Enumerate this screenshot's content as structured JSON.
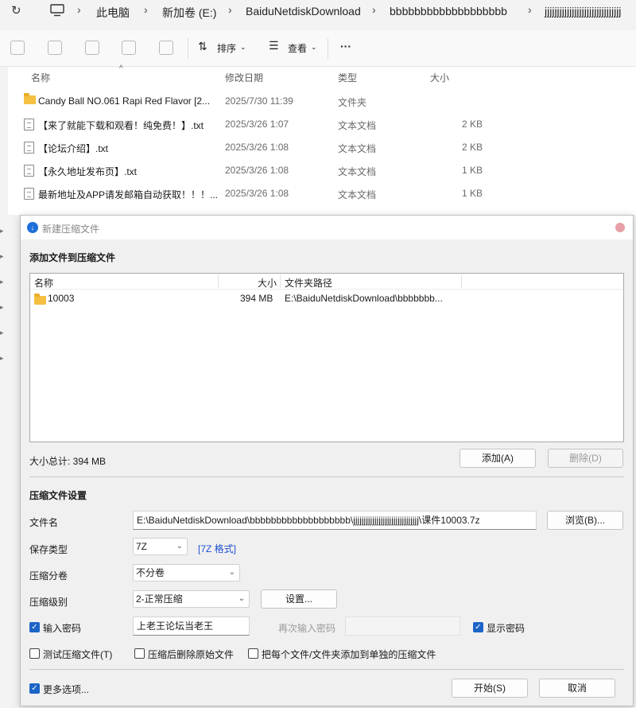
{
  "explorer": {
    "breadcrumb": [
      "此电脑",
      "新加卷 (E:)",
      "BaiduNetdiskDownload",
      "bbbbbbbbbbbbbbbbbbb",
      "jjjjjjjjjjjjjjjjjjjjjjjjjjjjjjj"
    ],
    "toolbar": {
      "sort_label": "排序",
      "view_label": "查看",
      "more_label": "···"
    },
    "columns": {
      "name": "名称",
      "date": "修改日期",
      "type": "类型",
      "size": "大小"
    },
    "files": [
      {
        "name": "Candy Ball NO.061 Rapi Red Flavor [2...",
        "date": "2025/7/30 11:39",
        "type": "文件夹",
        "size": "",
        "icon": "folder-icon"
      },
      {
        "name": "【来了就能下载和观看！纯免费！】.txt",
        "date": "2025/3/26 1:07",
        "type": "文本文档",
        "size": "2 KB",
        "icon": "text-file-icon"
      },
      {
        "name": "【论坛介绍】.txt",
        "date": "2025/3/26 1:08",
        "type": "文本文档",
        "size": "2 KB",
        "icon": "text-file-icon"
      },
      {
        "name": "【永久地址发布页】.txt",
        "date": "2025/3/26 1:08",
        "type": "文本文档",
        "size": "1 KB",
        "icon": "text-file-icon"
      },
      {
        "name": "最新地址及APP请发邮箱自动获取！！！...",
        "date": "2025/3/26 1:08",
        "type": "文本文档",
        "size": "1 KB",
        "icon": "text-file-icon"
      }
    ]
  },
  "dialog": {
    "title": "新建压缩文件",
    "add_section": "添加文件到压缩文件",
    "list_headers": {
      "name": "名称",
      "size": "大小",
      "path": "文件夹路径"
    },
    "items": [
      {
        "name": "10003",
        "size": "394 MB",
        "path": "E:\\BaiduNetdiskDownload\\bbbbbbb..."
      }
    ],
    "total_size": "大小总计: 394 MB",
    "add_button": "添加(A)",
    "delete_button": "删除(D)",
    "settings_section": "压缩文件设置",
    "filename_label": "文件名",
    "filename_value": "E:\\BaiduNetdiskDownload\\bbbbbbbbbbbbbbbbbbb\\jjjjjjjjjjjjjjjjjjjjjjjjjjjjjjj\\课件10003.7z",
    "browse_button": "浏览(B)...",
    "save_type_label": "保存类型",
    "save_type_value": "7Z",
    "format_link": "[7Z 格式]",
    "volume_label": "压缩分卷",
    "volume_value": "不分卷",
    "level_label": "压缩级别",
    "level_value": "2-正常压缩",
    "settings_button": "设置...",
    "password_label": "输入密码",
    "password_value": "上老王论坛当老王",
    "reenter_label": "再次输入密码",
    "show_password_label": "显示密码",
    "test_label": "测试压缩文件(T)",
    "delete_original_label": "压缩后删除原始文件",
    "separate_label": "把每个文件/文件夹添加到单独的压缩文件",
    "more_options_label": "更多选项...",
    "start_button": "开始(S)",
    "cancel_button": "取消",
    "checks": {
      "password": true,
      "show_password": true,
      "test": false,
      "delete_original": false,
      "separate": false,
      "more_options": true
    }
  }
}
